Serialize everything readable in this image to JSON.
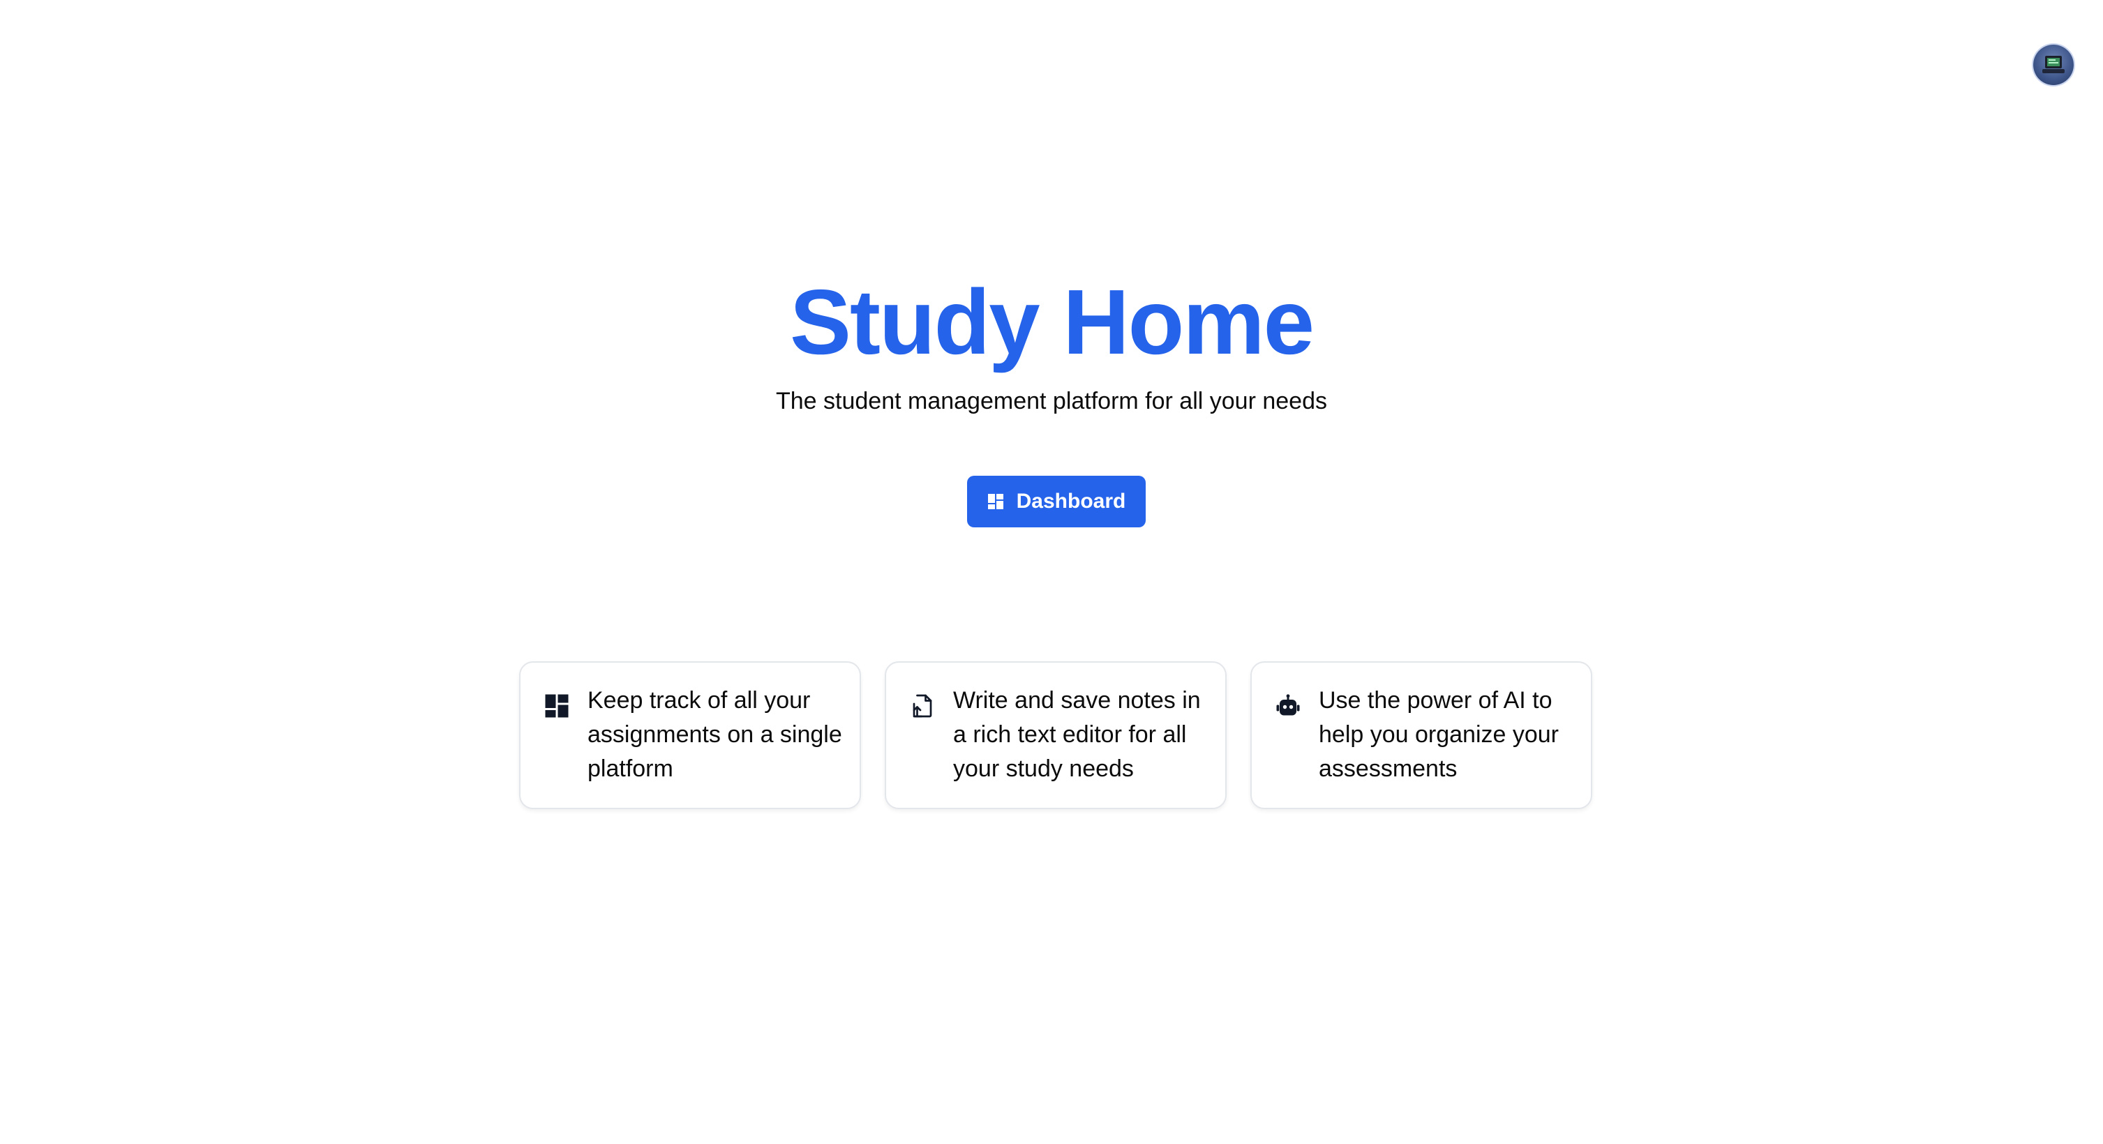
{
  "header": {
    "avatar_icon": "user-avatar-icon"
  },
  "hero": {
    "title": "Study Home",
    "subtitle": "The student management platform for all your needs",
    "primary_button": {
      "label": "Dashboard",
      "icon": "dashboard-grid-icon"
    }
  },
  "features": [
    {
      "icon": "dashboard-grid-icon",
      "text": "Keep track of all your assignments on a single platform"
    },
    {
      "icon": "file-upload-icon",
      "text": "Write and save notes in a rich text editor for all your study needs"
    },
    {
      "icon": "robot-icon",
      "text": "Use the power of AI to help you organize your assessments"
    }
  ],
  "colors": {
    "accent": "#2563eb",
    "text": "#0b0b0b",
    "card_border": "#e3e6ea",
    "background": "#ffffff"
  }
}
